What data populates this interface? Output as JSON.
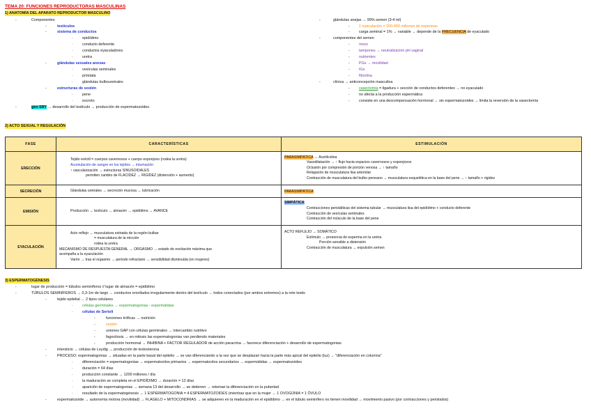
{
  "title": "TEMA 20: FUNCIONES REPRODUCTORAS MASCULINAS",
  "s1": {
    "heading": "1) ANATOMÍA DEL APARATO REPRODUCTOR MASCULINO",
    "componentes": "Componentes",
    "testiculos": "testículos",
    "sistema": "sistema de conductos",
    "epididimo": "epidídimo",
    "deferente": "conducto deferente",
    "eyaculadores": "conductos eyaculadores",
    "uretra": "uretra",
    "glandulas": "glándulas sexuales anexas",
    "vesiculas": "vesículas seminales",
    "prostata": "próstata",
    "bulbo": "glándulas bulbouretrales",
    "estructuras": "estructuras de sostén",
    "pene": "pene",
    "escroto": "escroto",
    "gen_pre": "gen SRY",
    "gen_post": " → desarrollo del testículo → producción de espermatozoides",
    "r1": "glándulas anejas → 99% semen (3-4 ml)",
    "r2": "1 eyaculación = 200-400 millones de espermas",
    "r3a": "carga seminal = 1% → variable → depende de la ",
    "r3b": "FRECUENCIA",
    "r3c": " de eyaculado",
    "r4": "componentes del semen",
    "r5": "moco",
    "r6": "tampones → neutralización pH vaginal",
    "r7": "nutrientes",
    "r8": "PGs → movilidad",
    "r9": "IGs",
    "r10": "fibrolina",
    "r11": "clínica → anticoncepción masculina",
    "r12a": "vasectomía",
    "r12b": " = ligadura + sección de conductos deferentes → no eyaculado",
    "r13": "no afecta a la producción espermática",
    "r14": "consiste en una descompensación hormonal → sin espermatozoides → limita la reversión de la vasectomía"
  },
  "s2": {
    "heading": "2) ACTO SEXUAL Y REGULACIÓN",
    "col_fase": "FASE",
    "col_car": "CARACTERÍSTICAS",
    "col_est": "ESTIMULACIÓN",
    "erec": "ERECCIÓN",
    "erec_c1": "Tejido eréctil = cuerpos cavernosos + cuerpo esponjoso (rodea la uretra)",
    "erec_c2": "Acumulación de sangre en los tejidos → intumación",
    "erec_c3": "↑ vascularización → estructuras SINUSOIDALES",
    "erec_c4": "permiten cambio de FLACIDEZ → RIGIDEZ (distensión + aumento)",
    "erec_e0": "PARASIMPÁTICA",
    "erec_e1": " → Acetilcolina",
    "erec_e2": "Vasodilatación → ↑ flujo hacia espacios cavernosos y esponjosos",
    "erec_e3": "Oclusión por compresión de porción venosa → ↑ tamaño",
    "erec_e4": "Relajación de musculatura lisa arteriolar",
    "erec_e5": "Contracción de musculatura del bulbo peneano → musculatura esquelética en la base del pene → ↑ tamaño + rigidez",
    "sec": "SECRECIÓN",
    "sec_c1": "Glándulas uretrales → secreción mucosa → lubricación",
    "sec_e0": "PARASIMPÁTICA",
    "emi": "EMISIÓN",
    "emi_c1": "Producción → testículo → almacén → epidídimo → AVANCE",
    "emi_e0": "SIMPÁTICA",
    "emi_e1": "Contracciones peristálticas del sistema tubular → musculatura lisa del epidídimo + conducto deferente",
    "emi_e2": "Contracción de vesículas seminales",
    "emi_e3": "Contracción del músculo de la base del pene",
    "eya": "EYACULACIÓN",
    "eya_c1": "Acto reflejo → musculatura estriada de la región bulbar",
    "eya_c2": "= musculatura de la micción",
    "eya_c3": "rodea la uretra",
    "eya_c4": "MECANISMO DE RESPUESTA GENERAL → ORGASMO → estado de excitación máxima que",
    "eya_c5": "acompaña a la eyaculación",
    "eya_c6": "Varón → tras el orgasmo → periodo refractario → sensibilidad disminuida (en mujeres)",
    "eya_e1": "ACTO REFLEJO → SOMÁTICO",
    "eya_e2": "Estímulo → presencia de esperma en la uretra",
    "eya_e3": "Porción sensible a distensión",
    "eya_e4": "Contracción de musculatura → expulsión semen"
  },
  "s3": {
    "heading": "3) ESPERMATOGÉNESIS",
    "l1": "lugar de producción = túbulos seminíferos // lugar de almacén = epidídimo",
    "l2": "TÚBULOS SEMINÍFEROS → 0,3-1m de largo → conductos enrollados irregularmente dentro del testículo → todos conectados (por ambos extremos) a la rete testis",
    "l3": "tejido epitelial → 2 tipos celulares",
    "l4": "células germinales → espermatogonias - espermátidas",
    "l5": "células de Sertoli",
    "l6": "funciones tróficas → nutrición",
    "l7": "sostén",
    "l8": "uniones GAP con células germinales → intercambio nutritivo",
    "l9": "fagocitosis → en mitosis las espermatogonias van perdiendo materiales",
    "l10": "producción hormonal → INHIBINA + FACTOR REGULADOR de acción paracrina → favorece diferenciación + desarrollo de espermatogonias",
    "l11": "intersticio → células de Leydig → producción de testosterona",
    "l12": "PROCESO: espermatogonias → situadas en la parte basal del epitelio → se van diferenciando a la vez que se desplazan hacia la parte más apical del epitelio (luz) → \"diferenciación en columna\"",
    "l13": "diferenciación = espermatogonias → espermatocitos primarios → espermatocitos secundarios → espermátidas → espermatozoides",
    "l14": "duración = 64 días",
    "l15": "producción constante → 1200 millones / día",
    "l16": "la maduración se completa en el EPIDÍDIMO → duración = 12 días",
    "l17": "aparición de espermatogonias → semana 13 del desarrollo → se detienen → retoman la diferenciación en la pubertad",
    "l18": "resultado de la espermatogénesis → 1 ESPERMATOGONIA = 4 ESPERMATOZOIDES (mientras que en la mujer → 1 OVOGONIA = 1 ÓVULO",
    "l19": "espermatozoide → autonomía motora (movilidad) → FLAGELO + MITOCONDRIAS → se adquieren en la maduración en el epidídimo → en el túbulo seminífero no tienen movilidad → movimiento pasivo (por contracciones y peristalsis)"
  }
}
